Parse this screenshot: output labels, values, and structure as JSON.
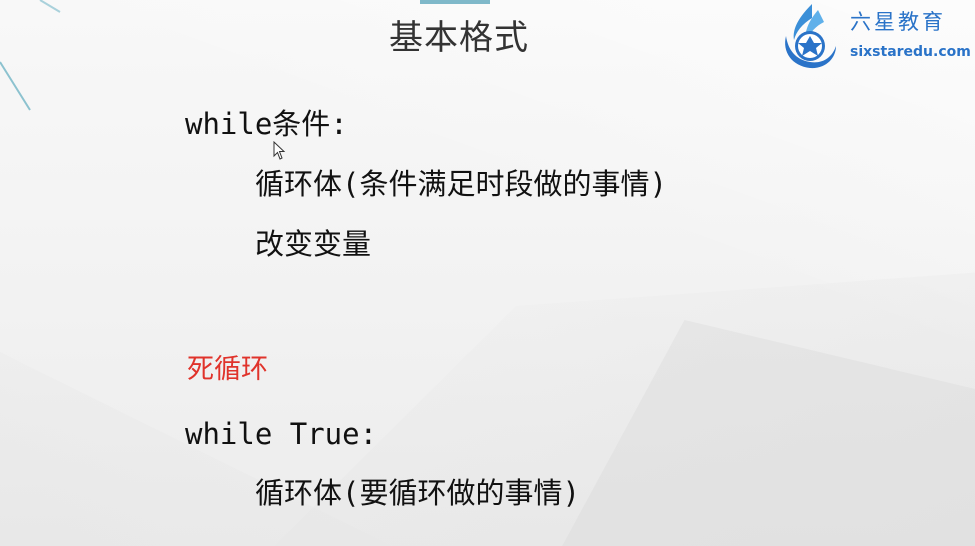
{
  "slide": {
    "title": "基本格式",
    "logo": {
      "name": "六星教育",
      "url": "sixstaredu.com"
    },
    "lines": {
      "while_condition": "while条件:",
      "loop_body": "循环体(条件满足时段做的事情)",
      "change_var": "改变变量",
      "dead_loop_label": "死循环",
      "while_true": "while True:",
      "dead_loop_body": "循环体(要循环做的事情)"
    }
  },
  "colors": {
    "accent_red": "#e0332b",
    "logo_blue": "#2a73c8",
    "teal": "#7fb8c9"
  },
  "icons": {
    "logo_mark": "sixstar-logo-icon",
    "cursor": "mouse-pointer-icon"
  }
}
